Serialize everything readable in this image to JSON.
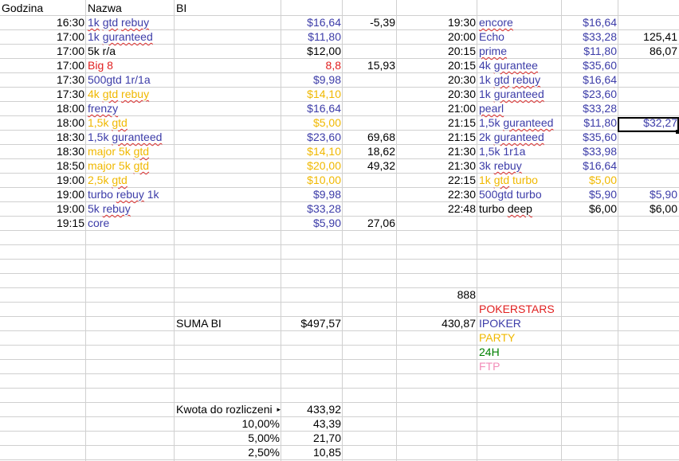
{
  "spreadsheet": {
    "headers": {
      "time": "Godzina",
      "name": "Nazwa",
      "bi": "BI"
    },
    "colors": {
      "default": "#000000",
      "party": "#f0b800",
      "ipoker": "#3c3ca8",
      "pokerstars": "#e02020",
      "h24": "#008000",
      "ftp": "#f28cb8",
      "grid": "#d0d0d0"
    },
    "left_rows": [
      {
        "time": "16:30",
        "name": "1k gtd rebuy",
        "spell": [
          "1k",
          "gtd",
          "rebuy"
        ],
        "bi": "$16,64",
        "result": "-5,39",
        "color": "ipoker"
      },
      {
        "time": "17:00",
        "name": "1k guranteed",
        "spell": [
          "guranteed"
        ],
        "bi": "$11,80",
        "result": "",
        "color": "ipoker"
      },
      {
        "time": "17:00",
        "name": "5k r/a",
        "spell": [],
        "bi": "$12,00",
        "result": "",
        "color": "default"
      },
      {
        "time": "17:00",
        "name": "Big 8",
        "spell": [],
        "bi": "8,8",
        "result": "15,93",
        "color": "pokerstars"
      },
      {
        "time": "17:30",
        "name": "500gtd 1r/1a",
        "spell": [],
        "bi": "$9,98",
        "result": "",
        "color": "ipoker"
      },
      {
        "time": "17:30",
        "name": "4k gtd rebuy",
        "spell": [
          "gtd",
          "rebuy"
        ],
        "bi": "$14,10",
        "result": "",
        "color": "party"
      },
      {
        "time": "18:00",
        "name": "frenzy",
        "spell": [
          "frenzy"
        ],
        "bi": "$16,64",
        "result": "",
        "color": "ipoker"
      },
      {
        "time": "18:00",
        "name": "1,5k gtd",
        "spell": [
          "gtd"
        ],
        "bi": "$5,00",
        "result": "",
        "color": "party"
      },
      {
        "time": "18:30",
        "name": "1,5k guranteed",
        "spell": [
          "guranteed"
        ],
        "bi": "$23,60",
        "result": "69,68",
        "color": "ipoker"
      },
      {
        "time": "18:30",
        "name": "major 5k gtd",
        "spell": [
          "gtd"
        ],
        "bi": "$14,10",
        "result": "18,62",
        "color": "party"
      },
      {
        "time": "18:50",
        "name": "major 5k gtd",
        "spell": [
          "gtd"
        ],
        "bi": "$20,00",
        "result": "49,32",
        "color": "party"
      },
      {
        "time": "19:00",
        "name": "2,5k gtd",
        "spell": [
          "gtd"
        ],
        "bi": "$10,00",
        "result": "",
        "color": "party"
      },
      {
        "time": "19:00",
        "name": "turbo rebuy 1k",
        "spell": [
          "rebuy"
        ],
        "bi": "$9,98",
        "result": "",
        "color": "ipoker"
      },
      {
        "time": "19:00",
        "name": "5k rebuy",
        "spell": [
          "rebuy"
        ],
        "bi": "$33,28",
        "result": "",
        "color": "ipoker"
      },
      {
        "time": "19:15",
        "name": "core",
        "spell": [],
        "bi": "$5,90",
        "result": "27,06",
        "color": "ipoker"
      }
    ],
    "right_rows": [
      {
        "time": "19:30",
        "name": "encore",
        "spell": [
          "encore"
        ],
        "bi": "$16,64",
        "result": "",
        "color": "ipoker"
      },
      {
        "time": "20:00",
        "name": "Echo",
        "spell": [],
        "bi": "$33,28",
        "result": "125,41",
        "color": "ipoker"
      },
      {
        "time": "20:15",
        "name": "prime",
        "spell": [
          "prime"
        ],
        "bi": "$11,80",
        "result": "86,07",
        "color": "ipoker"
      },
      {
        "time": "20:15",
        "name": "4k gurantee",
        "spell": [
          "gurantee"
        ],
        "bi": "$35,60",
        "result": "",
        "color": "ipoker"
      },
      {
        "time": "20:30",
        "name": "1k gtd rebuy",
        "spell": [
          "gtd",
          "rebuy"
        ],
        "bi": "$16,64",
        "result": "",
        "color": "ipoker"
      },
      {
        "time": "20:30",
        "name": "1k guranteed",
        "spell": [
          "guranteed"
        ],
        "bi": "$23,60",
        "result": "",
        "color": "ipoker"
      },
      {
        "time": "21:00",
        "name": "pearl",
        "spell": [
          "pearl"
        ],
        "bi": "$33,28",
        "result": "",
        "color": "ipoker"
      },
      {
        "time": "21:15",
        "name": "1,5k guranteed",
        "spell": [
          "guranteed"
        ],
        "bi": "$11,80",
        "result": "$32,27",
        "color": "ipoker"
      },
      {
        "time": "21:15",
        "name": "2k guranteed",
        "spell": [
          "guranteed"
        ],
        "bi": "$35,60",
        "result": "",
        "color": "ipoker"
      },
      {
        "time": "21:30",
        "name": "1,5k 1r1a",
        "spell": [],
        "bi": "$33,98",
        "result": "",
        "color": "ipoker"
      },
      {
        "time": "21:30",
        "name": "3k rebuy",
        "spell": [
          "rebuy"
        ],
        "bi": "$16,64",
        "result": "",
        "color": "ipoker"
      },
      {
        "time": "22:15",
        "name": "1k gtd turbo",
        "spell": [
          "gtd"
        ],
        "bi": "$5,00",
        "result": "",
        "color": "party"
      },
      {
        "time": "22:30",
        "name": "500gtd turbo",
        "spell": [],
        "bi": "$5,90",
        "result": "$5,90",
        "color": "ipoker"
      },
      {
        "time": "22:48",
        "name": "turbo deep",
        "spell": [
          "deep"
        ],
        "bi": "$6,00",
        "result": "$6,00",
        "color": "default"
      }
    ],
    "legend": [
      {
        "text": "888",
        "color": "default",
        "align": "right"
      },
      {
        "text": "POKERSTARS",
        "color": "pokerstars",
        "align": "left"
      },
      {
        "text": "IPOKER",
        "color": "ipoker",
        "align": "left"
      },
      {
        "text": "PARTY",
        "color": "party",
        "align": "left"
      },
      {
        "text": "24H",
        "color": "h24",
        "align": "left"
      },
      {
        "text": "FTP",
        "color": "ftp",
        "align": "left"
      }
    ],
    "sum": {
      "label": "SUMA BI",
      "value": "$497,57",
      "result": "430,87"
    },
    "settlement": {
      "label": "Kwota do rozliczeni",
      "overflow_marker": "▸",
      "value": "433,92",
      "rows": [
        {
          "pct": "10,00%",
          "val": "43,39"
        },
        {
          "pct": "5,00%",
          "val": "21,70"
        },
        {
          "pct": "2,50%",
          "val": "10,85"
        }
      ]
    },
    "selected_cell": {
      "row": 9,
      "col": 7,
      "value": "$32,27"
    }
  }
}
